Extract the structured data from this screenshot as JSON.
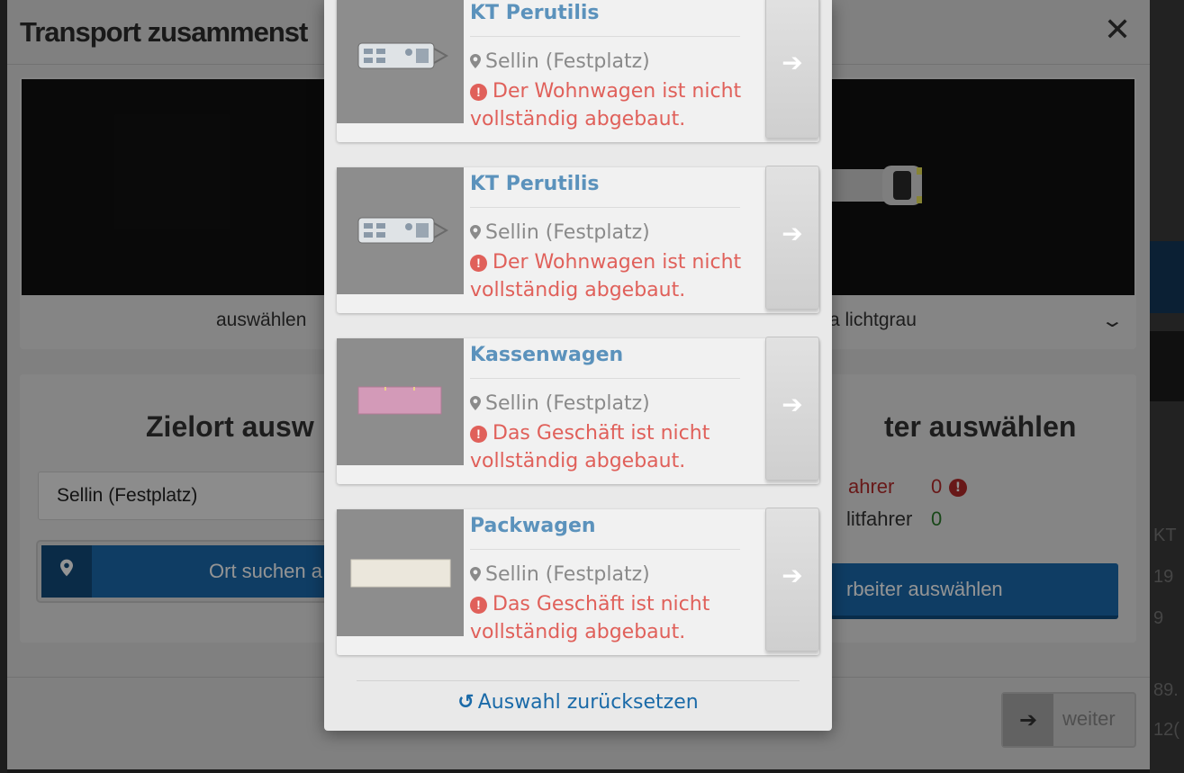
{
  "main_dialog": {
    "title": "Transport zusammenst",
    "close_label": "✕",
    "vehicle_select_left": "auswählen",
    "vehicle_select_right": "ra lichtgrau",
    "destination_heading": "Zielort ausw",
    "staff_heading": "ter auswählen",
    "destination_value": "Sellin (Festplatz)",
    "search_button_label": "Ort suchen a",
    "drivers_label": "ahrer",
    "drivers_count": "0",
    "passengers_label": "litfahrer",
    "passengers_count": "0",
    "staff_button_label": "rbeiter auswählen",
    "next_button_label": "weiter"
  },
  "background_right": {
    "texts": [
      "KT",
      "19",
      "9",
      "89.",
      "12("
    ]
  },
  "picker": {
    "items": [
      {
        "title": "KT Perutilis",
        "location": "Sellin (Festplatz)",
        "warning": "Der Wohnwagen ist nicht vollständig abgebaut.",
        "thumbnail": "caravan"
      },
      {
        "title": "KT Perutilis",
        "location": "Sellin (Festplatz)",
        "warning": "Der Wohnwagen ist nicht vollständig abgebaut.",
        "thumbnail": "caravan"
      },
      {
        "title": "Kassenwagen",
        "location": "Sellin (Festplatz)",
        "warning": "Das Geschäft ist nicht vollständig abgebaut.",
        "thumbnail": "pink-booth"
      },
      {
        "title": "Packwagen",
        "location": "Sellin (Festplatz)",
        "warning": "Das Geschäft ist nicht vollständig abgebaut.",
        "thumbnail": "cream-trailer"
      }
    ],
    "reset_label": "Auswahl zurücksetzen"
  },
  "icons": {
    "go": "arrow-right-icon",
    "location": "map-pin-icon",
    "warning": "exclamation-circle-icon",
    "reset": "undo-icon",
    "close": "close-icon",
    "chevron": "chevron-down-icon"
  },
  "colors": {
    "title_blue": "#5b92bc",
    "warning_red": "#e0605a",
    "link_blue": "#1a6aa8",
    "primary_button": "#1a6aad"
  }
}
